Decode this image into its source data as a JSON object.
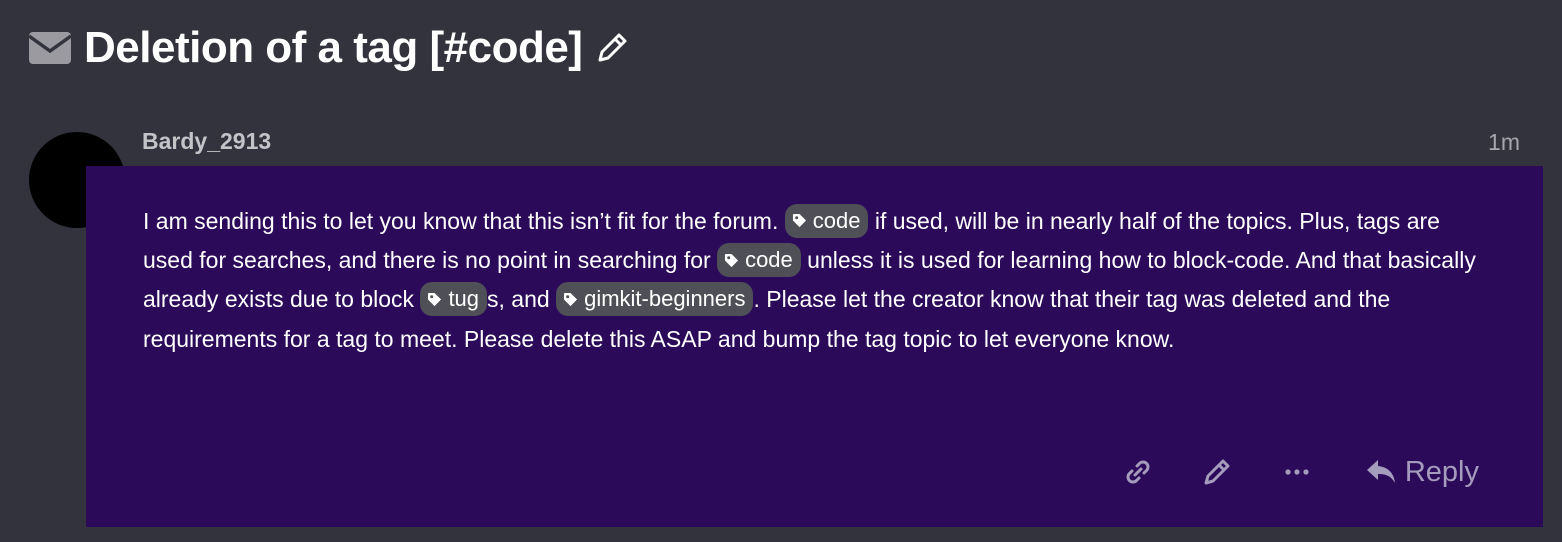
{
  "topic": {
    "title": "Deletion of a tag [#code]",
    "type_icon": "envelope-icon",
    "edit_icon": "pencil-icon"
  },
  "post": {
    "username": "Bardy_2913",
    "date": "1m",
    "avatar_color": "#000000",
    "body_background": "#2b0a5a",
    "segments": {
      "t1": "I am sending this to let you know that this isn’t fit for the forum. ",
      "t2": " if used, will be in nearly half of the topics. Plus, tags are used for searches, and there is no point in searching for ",
      "t3": " unless it is used for learning how to block-code. And that basically already exists due to block ",
      "t4": "s, and ",
      "t5": ". Please let the creator know that their tag was deleted and the requirements for a tag to meet. Please delete this ASAP and bump the tag topic to let everyone know."
    },
    "tags": [
      "code",
      "code",
      "tug",
      "gimkit-beginners"
    ],
    "actions": {
      "link_icon": "link-icon",
      "edit_icon": "pencil-icon",
      "more_icon": "ellipsis-icon",
      "reply_icon": "reply-arrow-icon",
      "reply_label": "Reply"
    }
  },
  "colors": {
    "page_background": "#32333d",
    "tag_background": "#4f4f57",
    "action_color": "#a59bbd"
  }
}
